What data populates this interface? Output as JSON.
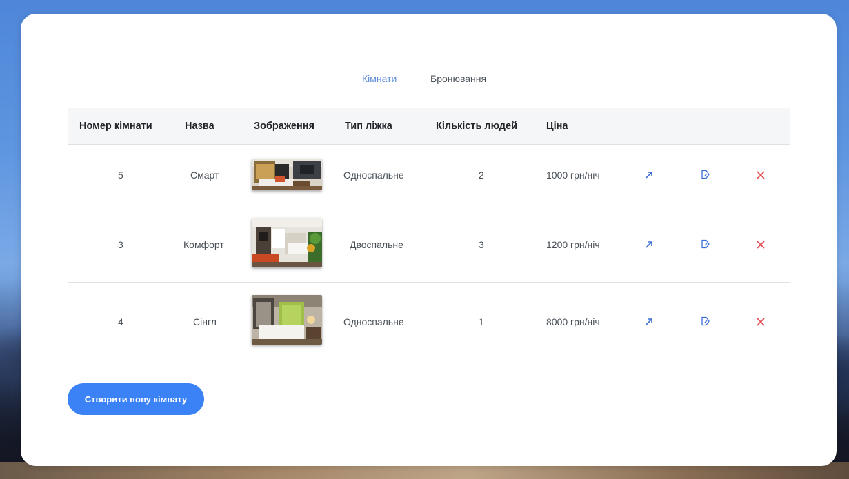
{
  "tabs": [
    {
      "label": "Кімнати"
    },
    {
      "label": "Бронювання"
    }
  ],
  "table": {
    "headers": [
      "Номер кімнати",
      "Назва",
      "Зображення",
      "Тип ліжка",
      "Кількість людей",
      "Ціна"
    ],
    "rows": [
      {
        "number": "5",
        "name": "Смарт",
        "bed": "Односпальне",
        "people": "2",
        "price": "1000 грн/ніч"
      },
      {
        "number": "3",
        "name": "Комфорт",
        "bed": "Двоспальне",
        "people": "3",
        "price": "1200 грн/ніч"
      },
      {
        "number": "4",
        "name": "Сінгл",
        "bed": "Односпальне",
        "people": "1",
        "price": "8000 грн/ніч"
      }
    ]
  },
  "icons": {
    "open": "arrow-up-right-icon",
    "edit": "edit-icon",
    "delete": "close-icon"
  },
  "colors": {
    "accent": "#3b82f6",
    "active_tab": "#5b8bd9",
    "delete": "#e5484d"
  },
  "create_button": {
    "label": "Створити нову кімнату"
  }
}
